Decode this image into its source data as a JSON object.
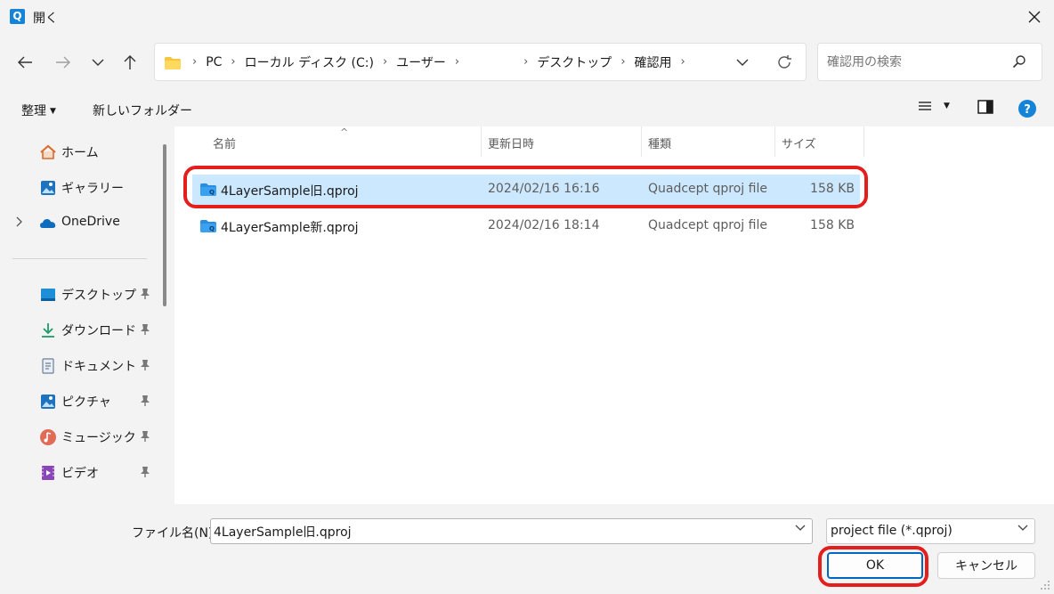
{
  "window": {
    "title": "開く",
    "app_icon_letter": "Q"
  },
  "nav": {
    "breadcrumbs": [
      "PC",
      "ローカル ディスク (C:)",
      "ユーザー",
      "",
      "デスクトップ",
      "確認用"
    ],
    "search_placeholder": "確認用の検索"
  },
  "toolbar": {
    "organize_label": "整理",
    "new_folder_label": "新しいフォルダー"
  },
  "sidebar": {
    "items": [
      {
        "label": "ホーム",
        "icon": "home-icon"
      },
      {
        "label": "ギャラリー",
        "icon": "gallery-icon"
      },
      {
        "label": "OneDrive",
        "icon": "onedrive-icon"
      },
      {
        "label": "デスクトップ",
        "icon": "desktop-icon",
        "pinned": true
      },
      {
        "label": "ダウンロード",
        "icon": "download-icon",
        "pinned": true
      },
      {
        "label": "ドキュメント",
        "icon": "documents-icon",
        "pinned": true
      },
      {
        "label": "ピクチャ",
        "icon": "pictures-icon",
        "pinned": true
      },
      {
        "label": "ミュージック",
        "icon": "music-icon",
        "pinned": true
      },
      {
        "label": "ビデオ",
        "icon": "videos-icon",
        "pinned": true
      }
    ]
  },
  "file_list": {
    "columns": [
      "名前",
      "更新日時",
      "種類",
      "サイズ"
    ],
    "files": [
      {
        "name": "4LayerSample旧.qproj",
        "modified": "2024/02/16 16:16",
        "type": "Quadcept qproj file",
        "size": "158 KB",
        "selected": true
      },
      {
        "name": "4LayerSample新.qproj",
        "modified": "2024/02/16 18:14",
        "type": "Quadcept qproj file",
        "size": "158 KB",
        "selected": false
      }
    ]
  },
  "bottom": {
    "filename_label": "ファイル名(N):",
    "filename_value": "4LayerSample旧.qproj",
    "filter_value": "project file (*.qproj)",
    "ok_label": "OK",
    "cancel_label": "キャンセル"
  },
  "colors": {
    "accent": "#0067c0",
    "selection": "#cce8ff",
    "highlight_annotation": "#e41d1d"
  }
}
